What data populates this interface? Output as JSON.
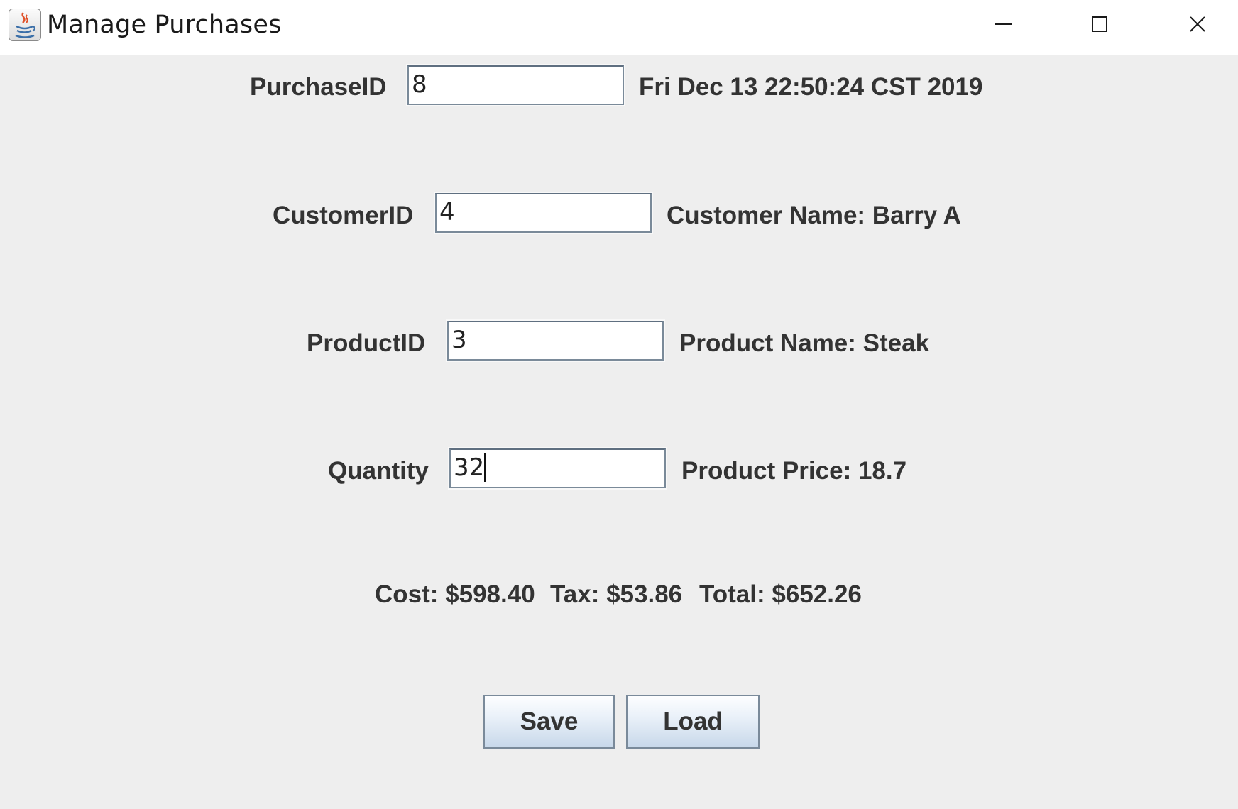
{
  "window": {
    "title": "Manage Purchases",
    "app_icon": "java-coffee-icon",
    "controls": [
      "minimize-icon",
      "maximize-icon",
      "close-icon"
    ]
  },
  "form": {
    "purchase_id": {
      "label": "PurchaseID",
      "value": "8",
      "info": "Fri Dec 13 22:50:24 CST 2019"
    },
    "customer_id": {
      "label": "CustomerID",
      "value": "4",
      "info": "Customer Name: Barry A"
    },
    "product_id": {
      "label": "ProductID",
      "value": "3",
      "info": "Product Name: Steak"
    },
    "quantity": {
      "label": "Quantity",
      "value": "32",
      "info": "Product Price: 18.7"
    }
  },
  "summary": {
    "cost": "Cost: $598.40",
    "tax": "Tax: $53.86",
    "total": "Total: $652.26"
  },
  "buttons": {
    "save": "Save",
    "load": "Load"
  },
  "colors": {
    "background": "#eeeeee",
    "text": "#333333",
    "button_gradient_bottom": "#c8d8ea"
  }
}
